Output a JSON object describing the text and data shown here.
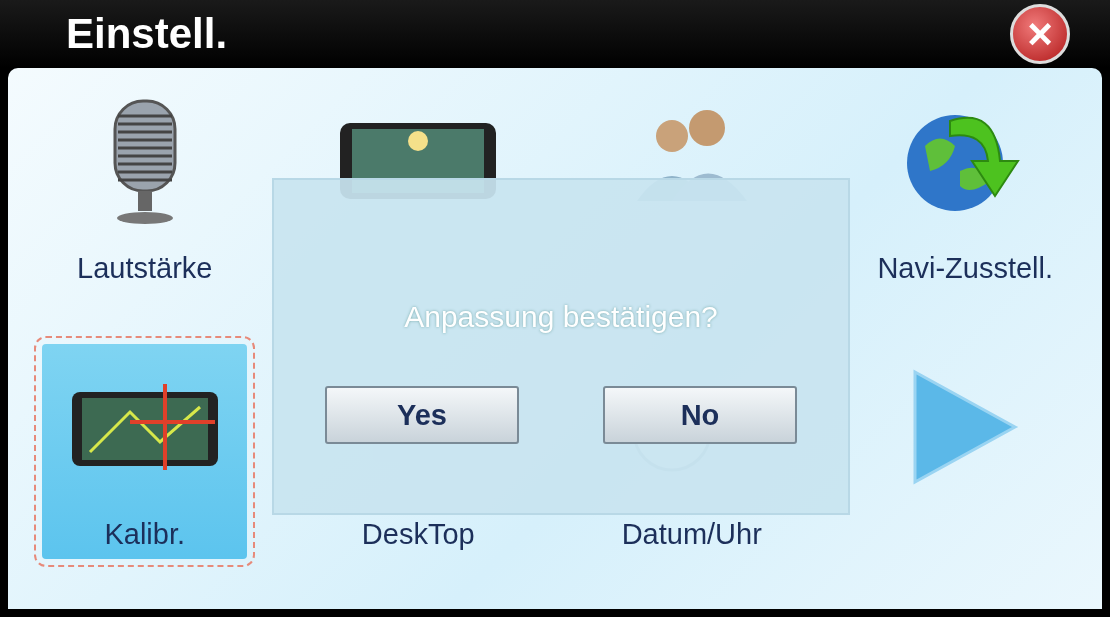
{
  "title_bar": {
    "title": "Einstell.",
    "close": "×"
  },
  "items": [
    {
      "kind": "microphone",
      "label": "Lautstärke",
      "selected": false
    },
    {
      "kind": "screen",
      "selected": false
    },
    {
      "kind": "people",
      "selected": false
    },
    {
      "kind": "globe",
      "label": "Navi-Zusstell.",
      "selected": false
    },
    {
      "kind": "calibrate",
      "label": "Kalibr.",
      "selected": true
    },
    {
      "kind": "desktop",
      "label": "DeskTop",
      "selected": false
    },
    {
      "kind": "clock",
      "label": "Datum/Uhr",
      "selected": false
    },
    {
      "kind": "next",
      "selected": false
    }
  ],
  "dialog": {
    "message": "Anpassung bestätigen?",
    "buttons": [
      "Yes",
      "No"
    ]
  }
}
